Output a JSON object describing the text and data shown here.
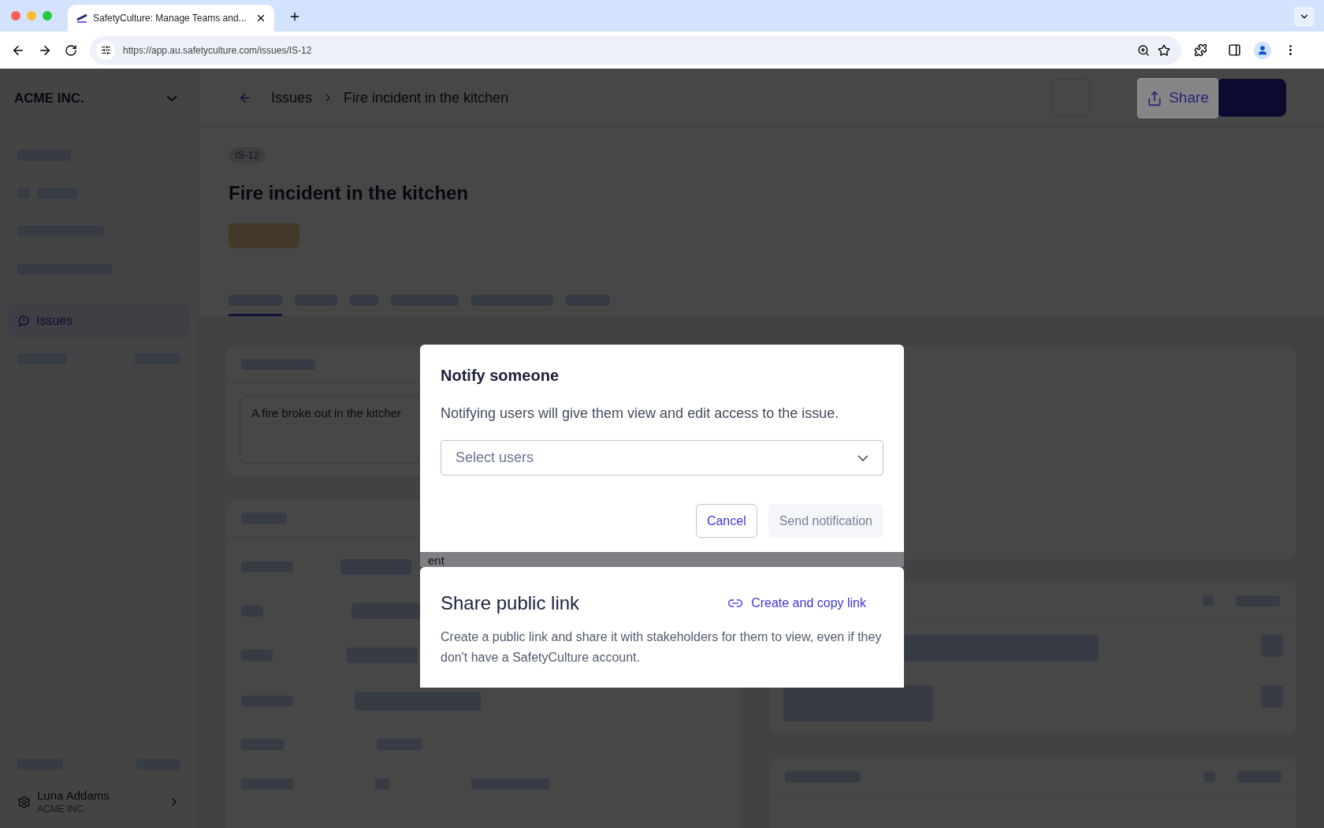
{
  "browser": {
    "tab_title": "SafetyCulture: Manage Teams and...",
    "url": "https://app.au.safetyculture.com/issues/IS-12"
  },
  "sidebar": {
    "org": "ACME INC.",
    "items": [
      {
        "label": "Issues",
        "selected": true
      }
    ],
    "user_name": "Luna Addams",
    "user_org": "ACME INC."
  },
  "header": {
    "breadcrumb": [
      "Issues",
      "Fire incident in the kitchen"
    ],
    "share_button": "Share"
  },
  "issue": {
    "id": "IS-12",
    "title": "Fire incident in the kitchen",
    "description": "A fire broke out in the kitcher",
    "detail_fragment": "ent"
  },
  "notify_dialog": {
    "title": "Notify someone",
    "message": "Notifying users will give them view and edit access to the issue.",
    "select_placeholder": "Select users",
    "cancel_button": "Cancel",
    "send_button": {
      "label": "Send notification",
      "disabled": true
    }
  },
  "share_link_panel": {
    "title": "Share public link",
    "link_label": "Create and copy link",
    "description": "Create a public link and share it with stakeholders for them to view, even if they don't have a SafetyCulture account."
  }
}
